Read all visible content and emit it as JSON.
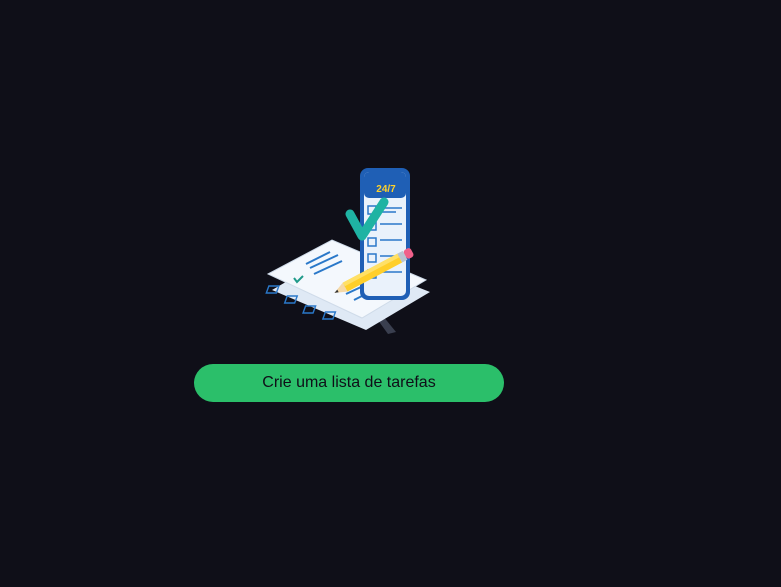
{
  "empty_state": {
    "illustration_icon": "checklist-phone-pencil-icon",
    "phone_screen_text": "24/7",
    "cta_label": "Crie uma lista de tarefas"
  },
  "colors": {
    "background": "#0f0f18",
    "button": "#2bbf6a",
    "button_text": "#0f0f18"
  }
}
